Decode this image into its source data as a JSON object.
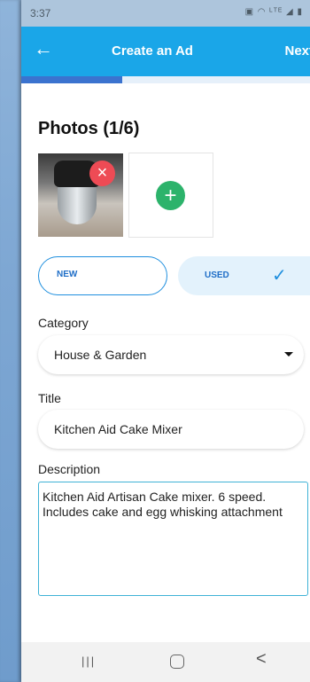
{
  "status_bar": {
    "time": "3:37",
    "icons_text": "▣ ◠ ᴸᵀᴱ ◢ ▮"
  },
  "app_bar": {
    "back_icon": "←",
    "title": "Create an Ad",
    "next_label": "Next"
  },
  "progress": {
    "fraction": 0.35
  },
  "photos": {
    "title": "Photos (1/6)",
    "remove_symbol": "×",
    "add_symbol": "+"
  },
  "condition": {
    "new_label": "NEW",
    "used_label": "USED",
    "selected": "USED",
    "check_symbol": "✓"
  },
  "category": {
    "label": "Category",
    "value": "House & Garden"
  },
  "title_field": {
    "label": "Title",
    "value": "Kitchen Aid Cake Mixer"
  },
  "description": {
    "label": "Description",
    "value": "Kitchen Aid Artisan Cake mixer. 6 speed. Includes cake and egg whisking attachment"
  },
  "nav": {
    "recents_symbol": "|||",
    "back_symbol": "<"
  },
  "colors": {
    "app_bar": "#1aa6e8",
    "progress": "#3b73cf",
    "remove": "#ee4b55",
    "add": "#2cb36b",
    "accent": "#1f8fde"
  }
}
